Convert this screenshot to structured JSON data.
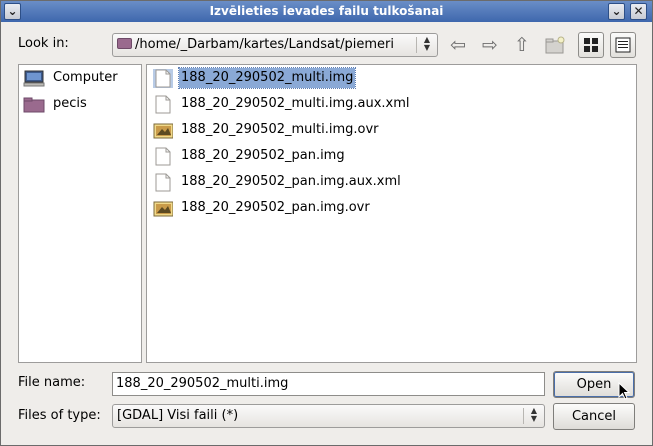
{
  "window": {
    "title": "Izvēlieties ievades failu tulkošanai",
    "menu_glyph": "⌄",
    "minimize_glyph": "⌄",
    "close_glyph": "✕"
  },
  "toolbar": {
    "look_in_label": "Look in:",
    "path": "/home/_Darbam/kartes/Landsat/piemeri",
    "back_glyph": "⇦",
    "forward_glyph": "⇨",
    "up_glyph": "⇧"
  },
  "places": [
    {
      "label": "Computer",
      "icon": "computer-icon"
    },
    {
      "label": "pecis",
      "icon": "folder-icon"
    }
  ],
  "files": [
    {
      "name": "188_20_290502_multi.img",
      "icon": "document-icon",
      "selected": true
    },
    {
      "name": "188_20_290502_multi.img.aux.xml",
      "icon": "document-icon",
      "selected": false
    },
    {
      "name": "188_20_290502_multi.img.ovr",
      "icon": "image-icon",
      "selected": false
    },
    {
      "name": "188_20_290502_pan.img",
      "icon": "document-icon",
      "selected": false
    },
    {
      "name": "188_20_290502_pan.img.aux.xml",
      "icon": "document-icon",
      "selected": false
    },
    {
      "name": "188_20_290502_pan.img.ovr",
      "icon": "image-icon",
      "selected": false
    }
  ],
  "footer": {
    "file_name_label": "File name:",
    "file_name_value": "188_20_290502_multi.img",
    "files_of_type_label": "Files of type:",
    "files_of_type_value": "[GDAL] Visi faili (*)",
    "open_label": "Open",
    "cancel_label": "Cancel"
  }
}
